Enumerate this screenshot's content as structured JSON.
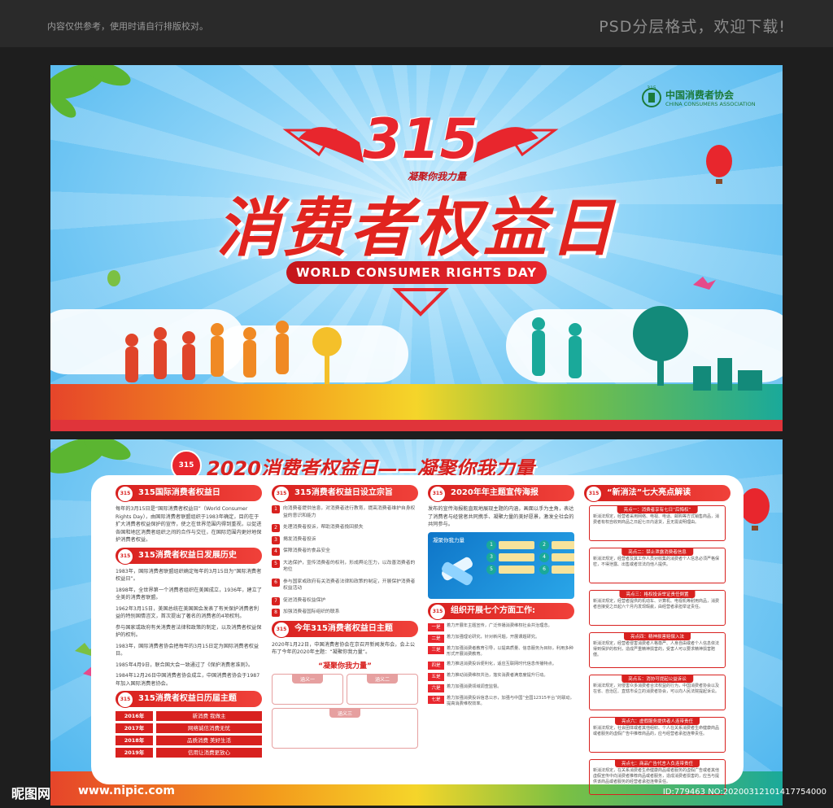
{
  "top_bar": {
    "notice": "内容仅供参考，使用时请自行排版校对。",
    "format_label": "PSD分层格式，欢迎下载!"
  },
  "banner": {
    "number": "315",
    "slogan_small": "凝聚你我力量",
    "title": "消费者权益日",
    "english_title": "WORLD CONSUMER RIGHTS DAY",
    "association_cn": "中国消费者协会",
    "association_en": "CHINA CONSUMERS ASSOCIATION"
  },
  "board": {
    "badge": "315",
    "title": "2020消费者权益日——凝聚你我力量",
    "col1": {
      "sec1_title": "315国际消费者权益日",
      "sec1_text": "每年的3月15日是“国际消费者权益日”（World Consumer Rights Day），由国际消费者联盟组织于1983年确定，目的在于扩大消费者权益保护的宣传，使之在世界范围内得到重视，以促进各国和地区消费者组织之间的合作与交往，在国际范围内更好地保护消费者权益。",
      "sec2_title": "315消费者权益日发展历史",
      "history": [
        "1983年，国际消费者联盟组织确定每年的3月15日为“国际消费者权益日”。",
        "1898年，全世界第一个消费者组织在美国成立，1936年，建立了全美的消费者联盟。",
        "1962年3月15日，美国总统在美国国会发表了有关保护消费者利益的特别国情咨文，首次提出了著名的消费者的4项权利。",
        "参与国家或政府有关消费者法律和政策的制定，以及消费者权益保护的权利。",
        "1983年，国际消费者协会把每年的3月15日定为国际消费者权益日。",
        "1985年4月9日，联合国大会一致通过了《保护消费者准则》。",
        "1984年12月26日中国消费者协会成立，中国消费者协会于1987年加入国际消费者协会。"
      ],
      "sec3_title": "315消费者权益日历届主题",
      "themes": [
        {
          "year": "2016年",
          "theme": "新消费 我做主"
        },
        {
          "year": "2017年",
          "theme": "网络诚信消费无忧"
        },
        {
          "year": "2018年",
          "theme": "品质消费 美好生活"
        },
        {
          "year": "2019年",
          "theme": "信用让消费更放心"
        }
      ]
    },
    "col2": {
      "sec1_title": "315消费者权益日设立宗旨",
      "aims": [
        "向消费者提供信息，对消费者进行教育，提高消费者维护自身权益的意识和能力",
        "处理消费者投诉，帮助消费者挽回损失",
        "揭发消费者投诉",
        "保障消费者的食品安全",
        "大选保护，宣传消费者的权利，形成舆论压力，以改善消费者的地位",
        "参与国家或政府有关消费者法律和政策的制定，开展保护消费者权益活动",
        "促进消费者权益保护",
        "加强消费者国际组织的联系"
      ],
      "sec2_title": "今年315消费者权益日主题",
      "theme_text": "2020年1月22日，中国消费者协会在京召开新闻发布会，会上公布了今年的2020年主题：“凝聚你我力量”。",
      "theme_highlight": "“凝聚你我力量”",
      "meaning1": "涵义一",
      "meaning2": "涵义二",
      "meaning3": "涵义三"
    },
    "col3": {
      "sec1_title": "2020年年主题宣传海报",
      "sec1_text": "发布的宣传海报能直观地展现主题的内涵，画面以手为主角，表达了消费者与经营者共同携手、凝聚力量的美好愿景，激发全社会的共同参与。",
      "poster_label": "凝聚你我力量",
      "bubble_numbers": [
        "1",
        "2",
        "3",
        "4",
        "5",
        "6"
      ],
      "sec2_title": "组织开展七个方面工作:",
      "aspects": [
        {
          "tag": "一是",
          "text": "着力开展年主题宣传，广泛传播消费维权社会共治理念。"
        },
        {
          "tag": "二是",
          "text": "着力加强理论研究，针对新问题，开展课题研究。"
        },
        {
          "tag": "三是",
          "text": "着力加强消费者教育引导，以提高质量、信息服务为目标，利用多种形式开展消费教育。"
        },
        {
          "tag": "四是",
          "text": "着力推进消费投诉便利化，适应互联网时代信息传播特点。"
        },
        {
          "tag": "五是",
          "text": "着力推动消费维权共治，落实消费者满意度提升行动。"
        },
        {
          "tag": "六是",
          "text": "着力加强消费领域调查监督。"
        },
        {
          "tag": "七是",
          "text": "着力加强消费投诉信息公示，加强与中国“全国12315平台”的联动，提高消费维权效率。"
        }
      ]
    },
    "col4": {
      "sec_title": "“新消法”七大亮点解读",
      "cards": [
        {
          "title": "亮点一：消费者享有七日“后悔权”",
          "text": "新消法规定，经营者采用网络、电视、电话、邮购等方式销售商品，消费者有权自收到商品之日起七日内退货，且无需说明理由。"
        },
        {
          "title": "亮点二：禁止泄露消费者信息",
          "text": "新消法规定，经营者及其工作人员对收集的消费者个人信息必须严格保密，不得泄露、出售或者非法向他人提供。"
        },
        {
          "title": "亮点三：格权投诉举证责任倒置",
          "text": "新消法规定，经营者提供的机动车、计算机、电视机等耐用商品，消费者自接受之日起六个月内发现瑕疵，由经营者承担举证责任。"
        },
        {
          "title": "亮点四：精神损害赔偿入法",
          "text": "新消法规定，经营者侵害消费者人格尊严、人身自由或者个人信息依法得到保护的权利，造成严重精神损害的，受害人可以要求精神损害赔偿。"
        },
        {
          "title": "亮点五：消协可提起公益诉讼",
          "text": "新消法规定，对侵害众多消费者合法权益的行为，中国消费者协会以及在省、自治区、直辖市设立的消费者协会，可以向人民法院提起诉讼。"
        },
        {
          "title": "亮点六：虚假服务提供者人连带责任",
          "text": "新消法规定，社会团体或者其他组织、个人在关系消费者生命健康商品或者服务的虚假广告中推荐商品的，应与经营者承担连带责任。"
        },
        {
          "title": "亮点七：商品广告代言人负连带责任",
          "text": "新消法规定，在关系消费者生命健康商品或者服务的虚假广告或者其他虚假宣传中向消费者推荐商品或者服务，造成消费者损害的，应当与提供该商品或者服务的经营者承担连带责任。"
        }
      ]
    }
  },
  "watermark": {
    "site": "昵图网",
    "url": "www.nipic.com",
    "id": "ID:779463 NO:20200312101417754000"
  },
  "colors": {
    "brand_red": "#d8211f",
    "sky_blue": "#4ab4ee",
    "green": "#1b7a3a"
  }
}
